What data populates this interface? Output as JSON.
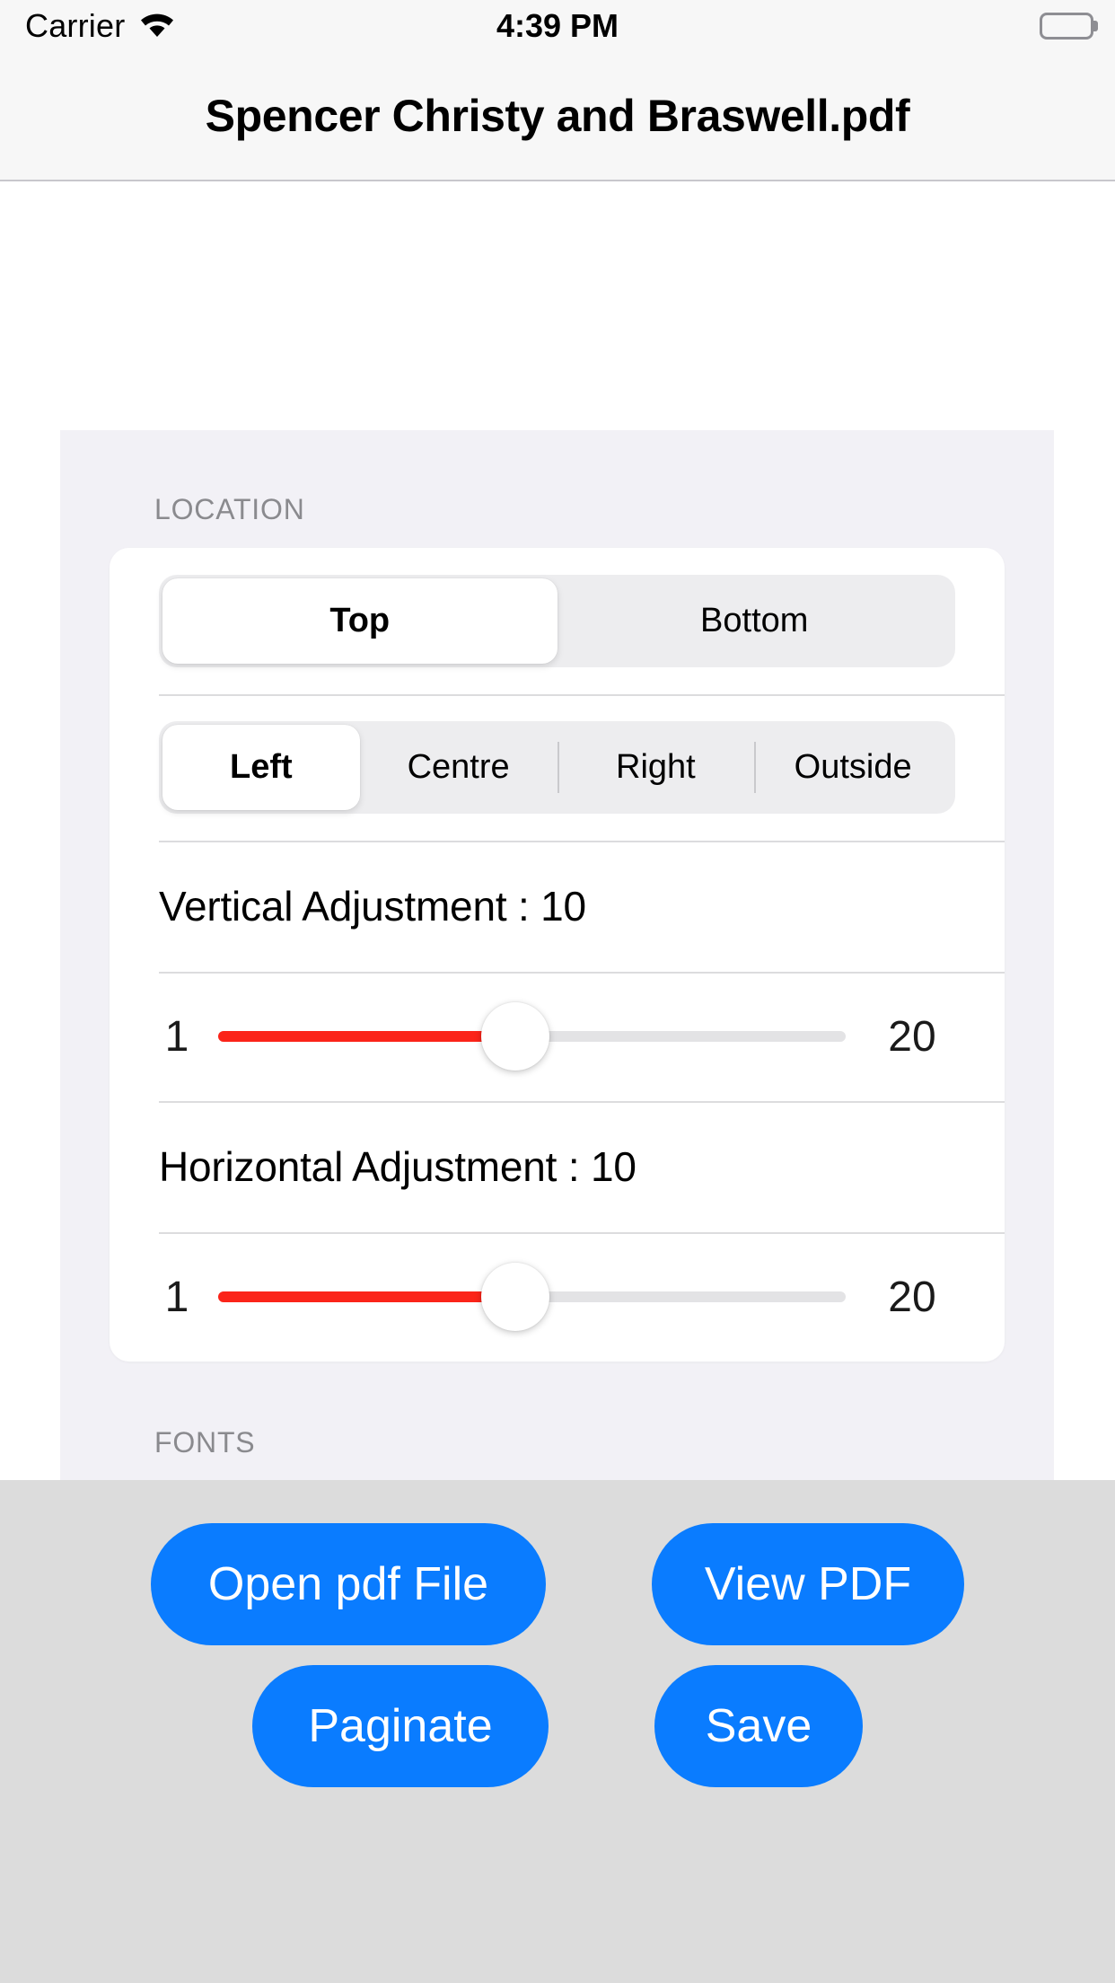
{
  "status_bar": {
    "carrier": "Carrier",
    "wifi_icon": "wifi-icon",
    "time": "4:39 PM",
    "battery_icon": "battery-full-icon"
  },
  "nav_bar": {
    "title": "Spencer Christy and Braswell.pdf"
  },
  "settings": {
    "sections": [
      {
        "header": "LOCATION",
        "vertical_segment": {
          "options": [
            "Top",
            "Bottom"
          ],
          "selected": "Top"
        },
        "alignment_segment": {
          "options": [
            "Left",
            "Centre",
            "Right",
            "Outside"
          ],
          "selected": "Left"
        },
        "vertical_adjustment": {
          "label": "Vertical Adjustment : 10",
          "value": 10,
          "min_label": "1",
          "max_label": "20",
          "min": 1,
          "max": 20
        },
        "horizontal_adjustment": {
          "label": "Horizontal Adjustment : 10",
          "value": 10,
          "min_label": "1",
          "max_label": "20",
          "min": 1,
          "max": 20
        }
      },
      {
        "header": "FONTS"
      }
    ]
  },
  "toolbar": {
    "open_pdf_label": "Open pdf File",
    "view_pdf_label": "View PDF",
    "paginate_label": "Paginate",
    "save_label": "Save"
  },
  "colors": {
    "accent_blue": "#0A7CFF",
    "slider_red": "#FB2419",
    "grouped_bg": "#F2F1F6",
    "bottom_bar": "#DCDCDC",
    "nav_bg": "#F7F7F7"
  }
}
